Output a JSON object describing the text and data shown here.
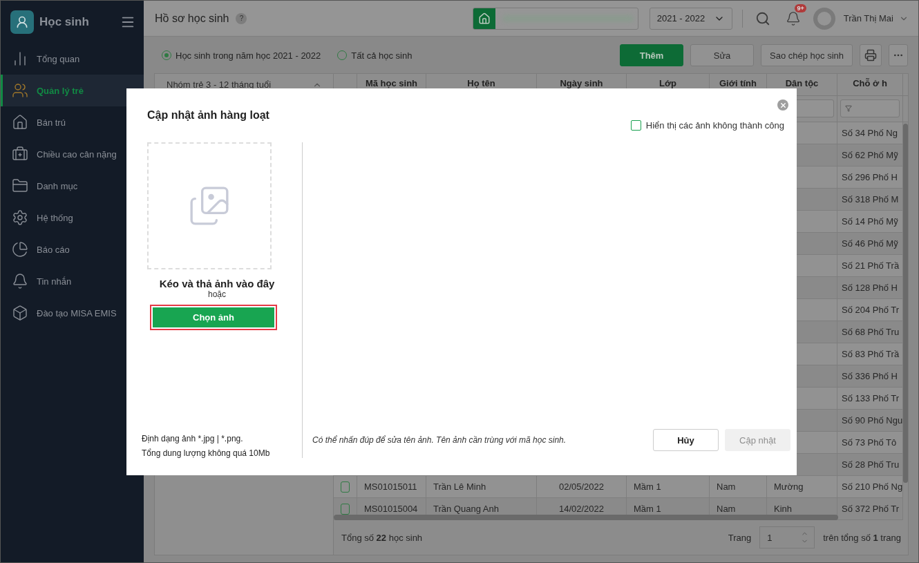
{
  "sidebar": {
    "app_title": "Học sinh",
    "items": [
      {
        "label": "Tổng quan",
        "selected": false
      },
      {
        "label": "Quản lý trẻ",
        "selected": true
      },
      {
        "label": "Bán trú",
        "selected": false
      },
      {
        "label": "Chiều cao cân nặng",
        "selected": false
      },
      {
        "label": "Danh mục",
        "selected": false
      },
      {
        "label": "Hệ thống",
        "selected": false
      },
      {
        "label": "Báo cáo",
        "selected": false
      },
      {
        "label": "Tin nhắn",
        "selected": false
      },
      {
        "label": "Đào tạo MISA EMIS",
        "selected": false
      }
    ]
  },
  "header": {
    "title": "Hồ sơ học sinh",
    "help": "?",
    "school_year": "2021 - 2022",
    "notification_badge": "9+",
    "user_name": "Trần Thị Mai"
  },
  "toolbar": {
    "filters": [
      {
        "label": "Học sinh trong năm học 2021 - 2022",
        "selected": true
      },
      {
        "label": "Tất cả học sinh",
        "selected": false
      }
    ],
    "buttons": [
      {
        "label": "Thêm",
        "kind": "primary"
      },
      {
        "label": "Sửa",
        "kind": "default"
      },
      {
        "label": "Sao chép học sinh",
        "kind": "default"
      }
    ]
  },
  "group_panel": {
    "header": "Nhóm trẻ 3 - 12 tháng tuổi"
  },
  "table": {
    "columns": [
      "Mã học sinh",
      "Họ tên",
      "Ngày sinh",
      "Lớp",
      "Giới tính",
      "Dân tộc",
      "Chỗ ở h"
    ],
    "rows": [
      {
        "address": "Số 34 Phố Ng"
      },
      {
        "address": "Số 62 Phố Mỹ"
      },
      {
        "address": "Số 296 Phố H"
      },
      {
        "address": "Số 318 Phố M"
      },
      {
        "address": "Số 14 Phố Mỹ"
      },
      {
        "address": "Số 46 Phố Mỹ"
      },
      {
        "address": "Số 21 Phố Trầ"
      },
      {
        "address": "Số 128 Phố H"
      },
      {
        "address": "Số 204 Phố Tr"
      },
      {
        "address": "Số 68 Phố Tru"
      },
      {
        "address": "Số 83 Phố Trầ"
      },
      {
        "address": "Số 336 Phố H"
      },
      {
        "address": "Số 133 Phố Tr"
      },
      {
        "address": "Số 90 Phố Ngu"
      },
      {
        "address": "Số 73 Phố Tô"
      },
      {
        "address": "Số 28 Phố Tru"
      },
      {
        "checked": false,
        "code": "MS01015011",
        "name": "Trần Lê Minh",
        "dob": "02/05/2022",
        "class": "Mầm 1",
        "gender": "Nam",
        "ethnicity": "Mường",
        "address": "Số 210 Phố Ng"
      },
      {
        "checked": false,
        "code": "MS01015004",
        "name": "Trần Quang Anh",
        "dob": "14/02/2022",
        "class": "Mầm 1",
        "gender": "Nam",
        "ethnicity": "Kinh",
        "address": "Số 372 Phố Tr"
      }
    ]
  },
  "footer": {
    "total": "Tổng số **22** học sinh",
    "page_label": "Trang",
    "page": "1",
    "page_total": "trên tổng số **1** trang"
  },
  "dialog": {
    "title": "Cập nhật ảnh hàng loạt",
    "show_failed": {
      "label": "Hiển thị các ảnh không thành công",
      "checked": false
    },
    "drop_text": "Kéo và thả ảnh vào đây",
    "or_text": "hoặc",
    "choose_button": {
      "label": "Chọn ảnh",
      "highlighted": true
    },
    "format_note": "Định dạng ảnh *.jpg | *.png.",
    "size_note": "Tổng dung lượng không quá 10Mb",
    "hint": "Có thể nhấn đúp để sửa tên ảnh. Tên ảnh cần trùng với mã học sinh.",
    "cancel_button": "Hủy",
    "update_button": {
      "label": "Cập nhật",
      "disabled": true
    }
  }
}
